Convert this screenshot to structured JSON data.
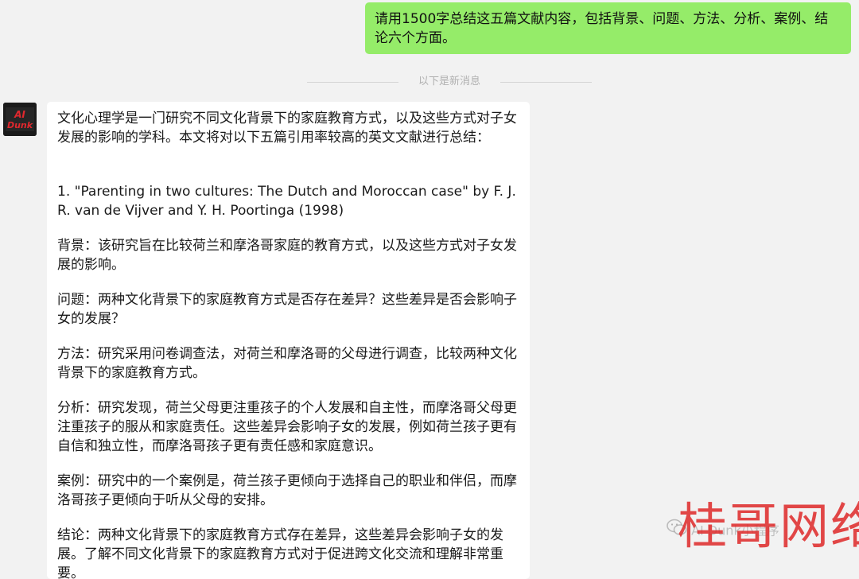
{
  "user_message": {
    "text": "请用1500字总结这五篇文献内容，包括背景、问题、方法、分析、案例、结论六个方面。"
  },
  "divider": {
    "label": "以下是新消息"
  },
  "assistant": {
    "avatar_text": "AI Dunk",
    "intro": "文化心理学是一门研究不同文化背景下的家庭教育方式，以及这些方式对子女发展的影响的学科。本文将对以下五篇引用率较高的英文文献进行总结：",
    "item_title": "1. \"Parenting in two cultures: The Dutch and Moroccan case\" by F. J. R. van de Vijver and Y. H. Poortinga (1998)",
    "sections": [
      {
        "text": "背景：该研究旨在比较荷兰和摩洛哥家庭的教育方式，以及这些方式对子女发展的影响。"
      },
      {
        "text": "问题：两种文化背景下的家庭教育方式是否存在差异？这些差异是否会影响子女的发展？"
      },
      {
        "text": "方法：研究采用问卷调查法，对荷兰和摩洛哥的父母进行调查，比较两种文化背景下的家庭教育方式。"
      },
      {
        "text": "分析：研究发现，荷兰父母更注重孩子的个人发展和自主性，而摩洛哥父母更注重孩子的服从和家庭责任。这些差异会影响子女的发展，例如荷兰孩子更有自信和独立性，而摩洛哥孩子更有责任感和家庭意识。"
      },
      {
        "text": "案例：研究中的一个案例是，荷兰孩子更倾向于选择自己的职业和伴侣，而摩洛哥孩子更倾向于听从父母的安排。"
      },
      {
        "text": "结论：两种文化背景下的家庭教育方式存在差异，这些差异会影响子女的发展。了解不同文化背景下的家庭教育方式对于促进跨文化交流和理解非常重要。"
      }
    ]
  },
  "watermark": {
    "small_text": "AI Dunk小程序",
    "big_text": "桂哥网络",
    "wechat_icon": "wechat-icon"
  },
  "colors": {
    "background": "#f2f2f2",
    "user_bubble": "#95ec69",
    "assistant_bubble": "#ffffff",
    "watermark_red": "#de2828"
  }
}
